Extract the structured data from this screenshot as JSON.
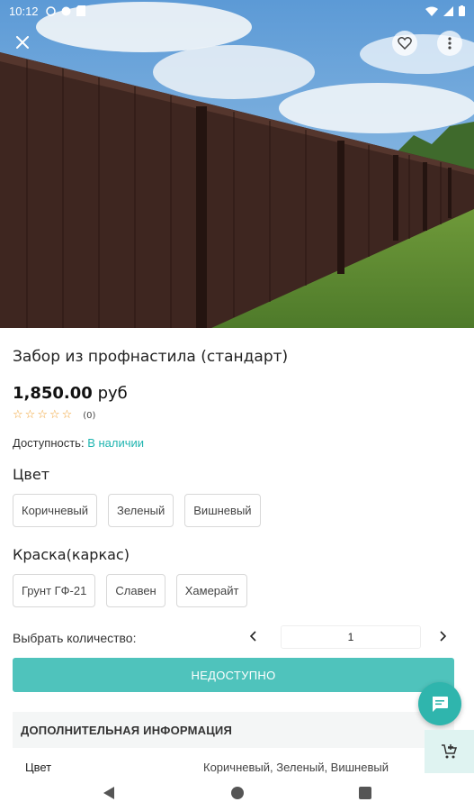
{
  "status_bar": {
    "time": "10:12"
  },
  "product": {
    "title": "Забор из профнастила (стандарт)",
    "price": "1,850.00",
    "currency": "руб",
    "rating_count": "(0)",
    "availability_label": "Доступность:",
    "availability_value": "В наличии"
  },
  "options": {
    "color": {
      "label": "Цвет",
      "choices": [
        "Коричневый",
        "Зеленый",
        "Вишневый"
      ]
    },
    "paint": {
      "label": "Краска(каркас)",
      "choices": [
        "Грунт ГФ-21",
        "Славен",
        "Хамерайт"
      ]
    }
  },
  "quantity": {
    "label": "Выбрать количество:",
    "value": "1"
  },
  "buttons": {
    "unavailable": "НЕДОСТУПНО"
  },
  "additional_info": {
    "header": "ДОПОЛНИТЕЛЬНАЯ ИНФОРМАЦИЯ",
    "spec_key": "Цвет",
    "spec_value": "Коричневый, Зеленый, Вишневый"
  },
  "icons": {
    "close": "close-icon",
    "favorite": "heart-icon",
    "more": "more-vert-icon",
    "chat": "chat-icon",
    "cart": "add-to-cart-icon",
    "star": "star-outline-icon"
  },
  "colors": {
    "accent": "#4fc3bc",
    "availability": "#1fb5b0",
    "star": "#f0a030"
  }
}
